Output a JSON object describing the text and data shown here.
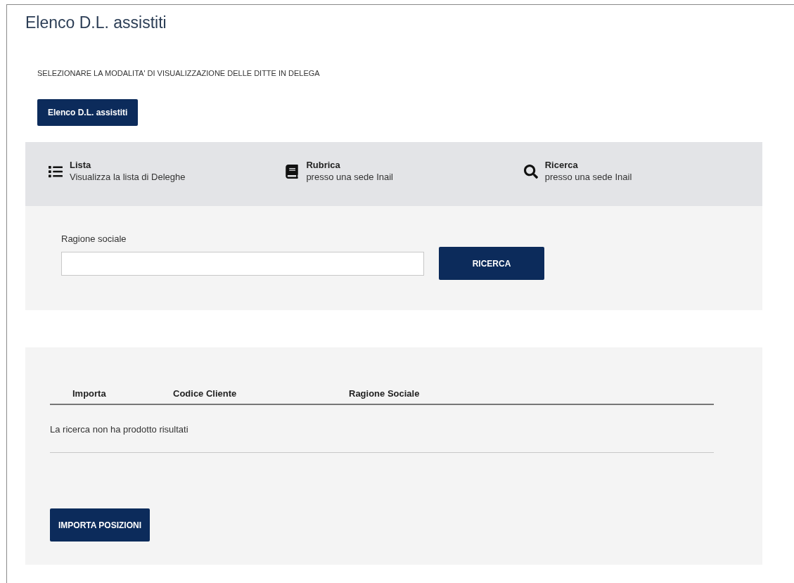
{
  "page_title": "Elenco D.L. assistiti",
  "instruction": "SELEZIONARE LA MODALITA' DI VISUALIZZAZIONE DELLE DITTE IN DELEGA",
  "mode_button": "Elenco D.L. assistiti",
  "tabs": [
    {
      "title": "Lista",
      "subtitle": "Visualizza la lista di Deleghe"
    },
    {
      "title": "Rubrica",
      "subtitle": "presso una sede Inail"
    },
    {
      "title": "Ricerca",
      "subtitle": "presso una sede Inail"
    }
  ],
  "search": {
    "label": "Ragione sociale",
    "button": "RICERCA"
  },
  "table": {
    "columns": [
      "Importa",
      "Codice Cliente",
      "Ragione Sociale"
    ],
    "empty_message": "La ricerca non ha prodotto risultati"
  },
  "import_button": "IMPORTA POSIZIONI"
}
